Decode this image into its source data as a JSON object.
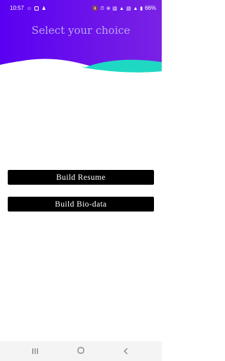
{
  "status_bar": {
    "time": "10:57",
    "battery": "66%",
    "icons": [
      "snapchat-icon",
      "checkbox-icon",
      "person-icon",
      "mute-icon",
      "alarm-icon",
      "hotspot-icon",
      "volte-icon",
      "signal-icon",
      "battery-icon"
    ]
  },
  "header": {
    "title": "Select your choice",
    "gradient_colors": [
      "#5800f0",
      "#7b1fe6"
    ],
    "wave_accent_color": "#1fd8c4"
  },
  "buttons": {
    "resume": "Build Resume",
    "biodata": "Build Bio-data"
  },
  "nav_bar": {
    "items": [
      "recent-apps",
      "home",
      "back"
    ]
  }
}
